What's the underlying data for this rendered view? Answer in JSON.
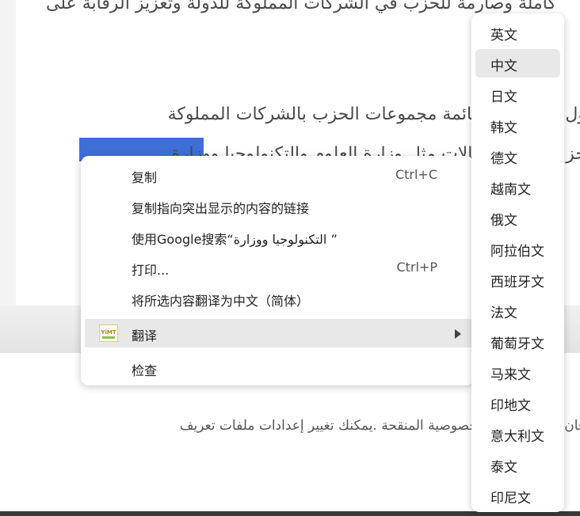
{
  "article": {
    "line1": "كاملة وصارمة للحزب في الشركات المملوكة للدولة وتعزيز الرقابة على",
    "line2": "ول . وتشمل القائمة مجموعات الحزب بالشركات المملوكة",
    "line3": "حز  عم في المجالات مثل وزارة العلوم والتكنولوجيا ووزارة"
  },
  "footer_text": "فان  ط ، وسياسة الخصوصية المنقحة .يمكنك تغيير إعدادات ملفات تعريف",
  "context_menu": {
    "copy": "复制",
    "copy_shortcut": "Ctrl+C",
    "copy_link": "复制指向突出显示的内容的链接",
    "search_google": "使用Google搜索“التكنولوجيا ووزارة ”",
    "print": "打印...",
    "print_shortcut": "Ctrl+P",
    "translate_selection": "将所选内容翻译为中文（简体）",
    "translate": "翻译",
    "translate_icon_text": "YiMT",
    "inspect": "检查"
  },
  "submenu": {
    "items": [
      "英文",
      "中文",
      "日文",
      "韩文",
      "德文",
      "越南文",
      "俄文",
      "阿拉伯文",
      "西班牙文",
      "法文",
      "葡萄牙文",
      "马来文",
      "印地文",
      "意大利文",
      "泰文",
      "印尼文"
    ],
    "highlighted": "中文"
  },
  "colors": {
    "selection": "#3d6fd6",
    "menu_highlight": "#e8e8e8"
  }
}
